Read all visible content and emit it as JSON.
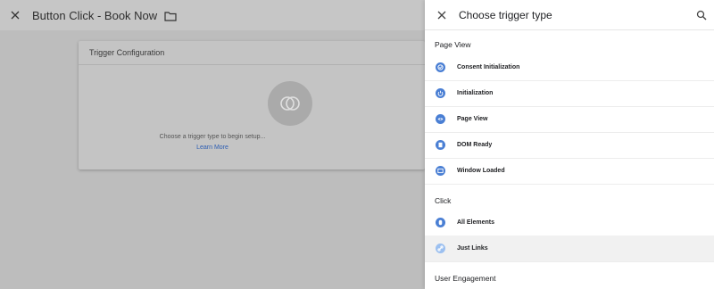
{
  "editor": {
    "title": "Button Click - Book Now",
    "card_title": "Trigger Configuration",
    "hint": "Choose a trigger type to begin setup...",
    "learn_more": "Learn More"
  },
  "panel": {
    "title": "Choose trigger type",
    "sections": [
      {
        "title": "Page View",
        "items": [
          {
            "label": "Consent Initialization",
            "icon": "consent-icon"
          },
          {
            "label": "Initialization",
            "icon": "power-icon"
          },
          {
            "label": "Page View",
            "icon": "eye-icon"
          },
          {
            "label": "DOM Ready",
            "icon": "document-icon"
          },
          {
            "label": "Window Loaded",
            "icon": "window-icon"
          }
        ]
      },
      {
        "title": "Click",
        "items": [
          {
            "label": "All Elements",
            "icon": "mouse-icon"
          },
          {
            "label": "Just Links",
            "icon": "link-icon"
          }
        ]
      },
      {
        "title": "User Engagement",
        "items": []
      }
    ]
  },
  "colors": {
    "accent": "#4a7fd4",
    "accent_light": "#9cc0f0",
    "link": "#2f5fb3",
    "highlight_row": "#f1f1f1"
  }
}
